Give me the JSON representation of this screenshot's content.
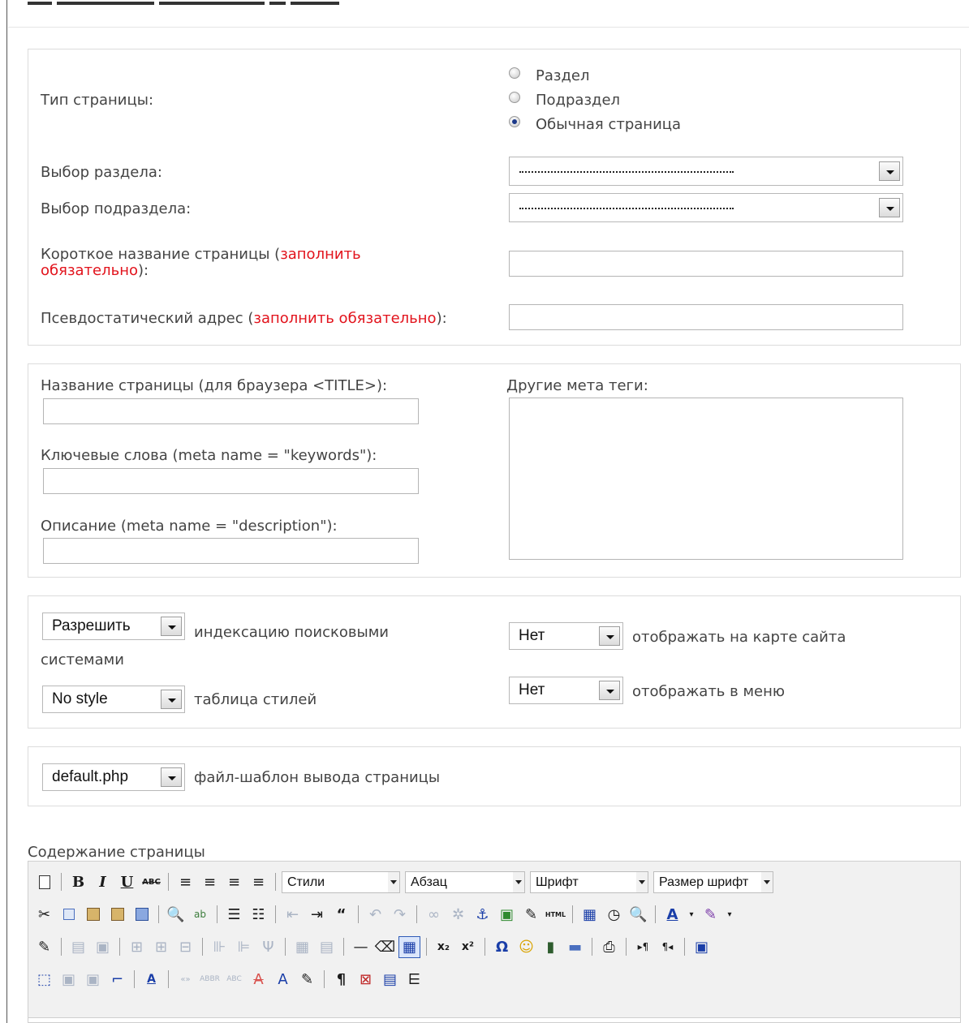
{
  "page_type": {
    "label": "Тип страницы:",
    "options": [
      "Раздел",
      "Подраздел",
      "Обычная страница"
    ],
    "selected": "Обычная страница"
  },
  "section_select": {
    "label": "Выбор раздела:",
    "value": "--------------------------------"
  },
  "subsection_select": {
    "label": "Выбор подраздела:",
    "value": "--------------------------------"
  },
  "short_name": {
    "label_prefix": "Короткое название страницы (",
    "required": "заполнить обязательно",
    "label_suffix": "):",
    "value": ""
  },
  "pseudo_address": {
    "label_prefix": "Псевдостатический адрес (",
    "required": "заполнить обязательно",
    "label_suffix": "):",
    "value": ""
  },
  "meta": {
    "title_label": "Название страницы (для браузера <TITLE>):",
    "keywords_label": "Ключевые слова (meta name = \"keywords\"):",
    "description_label": "Описание (meta name = \"description\"):",
    "other_label": "Другие мета теги:",
    "title_value": "",
    "keywords_value": "",
    "description_value": "",
    "other_value": ""
  },
  "options": {
    "indexing_value": "Разрешить",
    "indexing_text": "индексацию поисковыми системами",
    "stylesheet_value": "No style",
    "stylesheet_text": "таблица стилей",
    "sitemap_value": "Нет",
    "sitemap_text": "отображать на карте сайта",
    "menu_value": "Нет",
    "menu_text": "отображать в меню"
  },
  "template": {
    "value": "default.php",
    "text": "файл-шаблон вывода страницы"
  },
  "content": {
    "label": "Содержание страницы",
    "toolbar": {
      "styles": "Стили",
      "paragraph": "Абзац",
      "font": "Шрифт",
      "font_size": "Размер шрифт"
    }
  },
  "colors": {
    "required": "#e2131c",
    "radio_dot": "#1d3a8a",
    "link_icon": "#1a3ea8"
  }
}
